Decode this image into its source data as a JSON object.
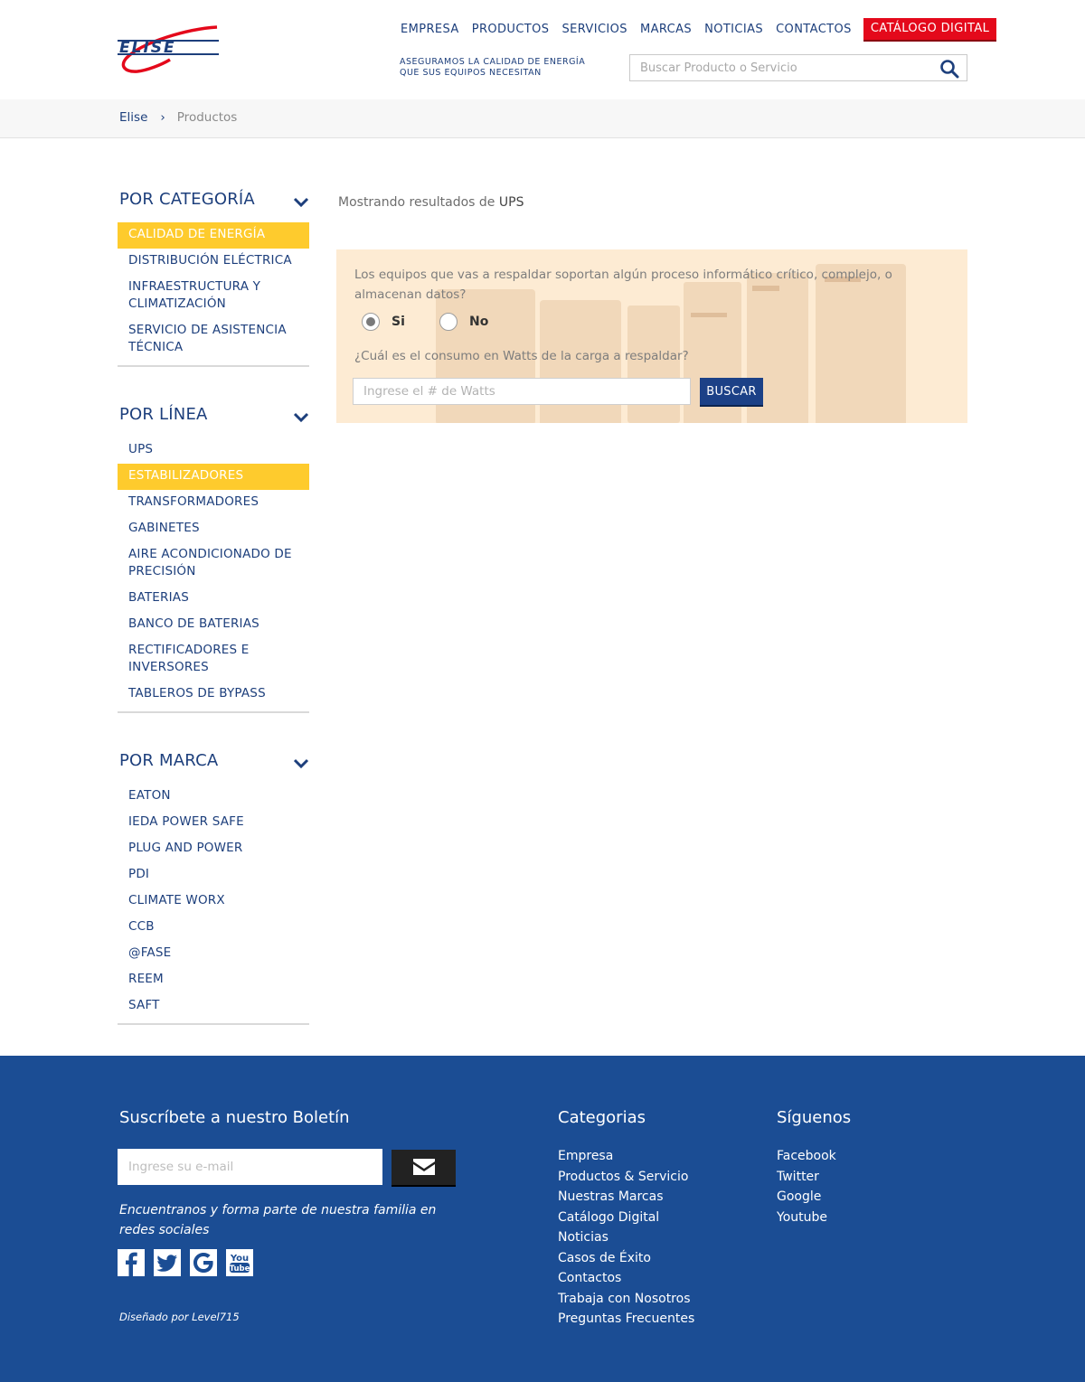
{
  "header": {
    "logo_text": "ELISE",
    "nav": [
      "EMPRESA",
      "PRODUCTOS",
      "SERVICIOS",
      "MARCAS",
      "NOTICIAS",
      "CONTACTOS"
    ],
    "catalog_label": "CATÁLOGO DIGITAL",
    "tagline_1": "ASEGURAMOS LA CALIDAD DE ENERGÍA",
    "tagline_2": "QUE SUS EQUIPOS NECESITAN",
    "search_placeholder": "Buscar Producto o Servicio"
  },
  "breadcrumb": {
    "home": "Elise",
    "separator": "›",
    "current": "Productos"
  },
  "sidebar": {
    "groups": [
      {
        "title": "POR CATEGORÍA",
        "items": [
          "CALIDAD DE ENERGÍA",
          "DISTRIBUCIÓN ELÉCTRICA",
          "INFRAESTRUCTURA Y CLIMATIZACIÓN",
          "SERVICIO DE ASISTENCIA TÉCNICA"
        ],
        "highlighted_index": 0
      },
      {
        "title": "POR LÍNEA",
        "items": [
          "UPS",
          "ESTABILIZADORES",
          "TRANSFORMADORES",
          "GABINETES",
          "AIRE ACONDICIONADO DE PRECISIÓN",
          "BATERIAS",
          "BANCO DE BATERIAS",
          "RECTIFICADORES E INVERSORES",
          "TABLEROS DE BYPASS"
        ],
        "highlighted_index": 1
      },
      {
        "title": "POR MARCA",
        "items": [
          "EATON",
          "IEDA POWER SAFE",
          "PLUG AND POWER",
          "PDI",
          "CLIMATE WORX",
          "CCB",
          "@FASE",
          "REEM",
          "SAFT"
        ],
        "highlighted_index": -1
      }
    ]
  },
  "main": {
    "showing_prefix": "Mostrando resultados de",
    "showing_query": "UPS",
    "question_1": "Los equipos que vas a respaldar soportan algún proceso informático crítico, complejo, o almacenan datos?",
    "option_yes": "Si",
    "option_no": "No",
    "selected": "Si",
    "question_2": "¿Cuál es el consumo en Watts de la carga a respaldar?",
    "watts_placeholder": "Ingrese el # de Watts",
    "search_button": "BUSCAR"
  },
  "footer": {
    "newsletter_title": "Suscríbete a nuestro Boletín",
    "email_placeholder": "Ingrese su e-mail",
    "social_tagline": "Encuentranos y forma parte de nuestra familia en redes sociales",
    "designed_by": "Diseñado por Level715",
    "categories_title": "Categorias",
    "categories": [
      "Empresa",
      "Productos & Servicio",
      "Nuestras Marcas",
      "Catálogo Digital",
      "Noticias",
      "Casos de Éxito",
      "Contactos",
      "Trabaja con Nosotros",
      "Preguntas Frecuentes"
    ],
    "follow_title": "Síguenos",
    "follow": [
      "Facebook",
      "Twitter",
      "Google",
      "Youtube"
    ],
    "social_icons": [
      "facebook-icon",
      "twitter-icon",
      "google-icon",
      "youtube-icon"
    ]
  },
  "colors": {
    "brand_blue": "#1d3f7c",
    "accent_red": "#e4091b",
    "highlight_yellow": "#fecb2d",
    "footer_blue": "#1b4d94",
    "question_bg": "#fdebd3"
  }
}
